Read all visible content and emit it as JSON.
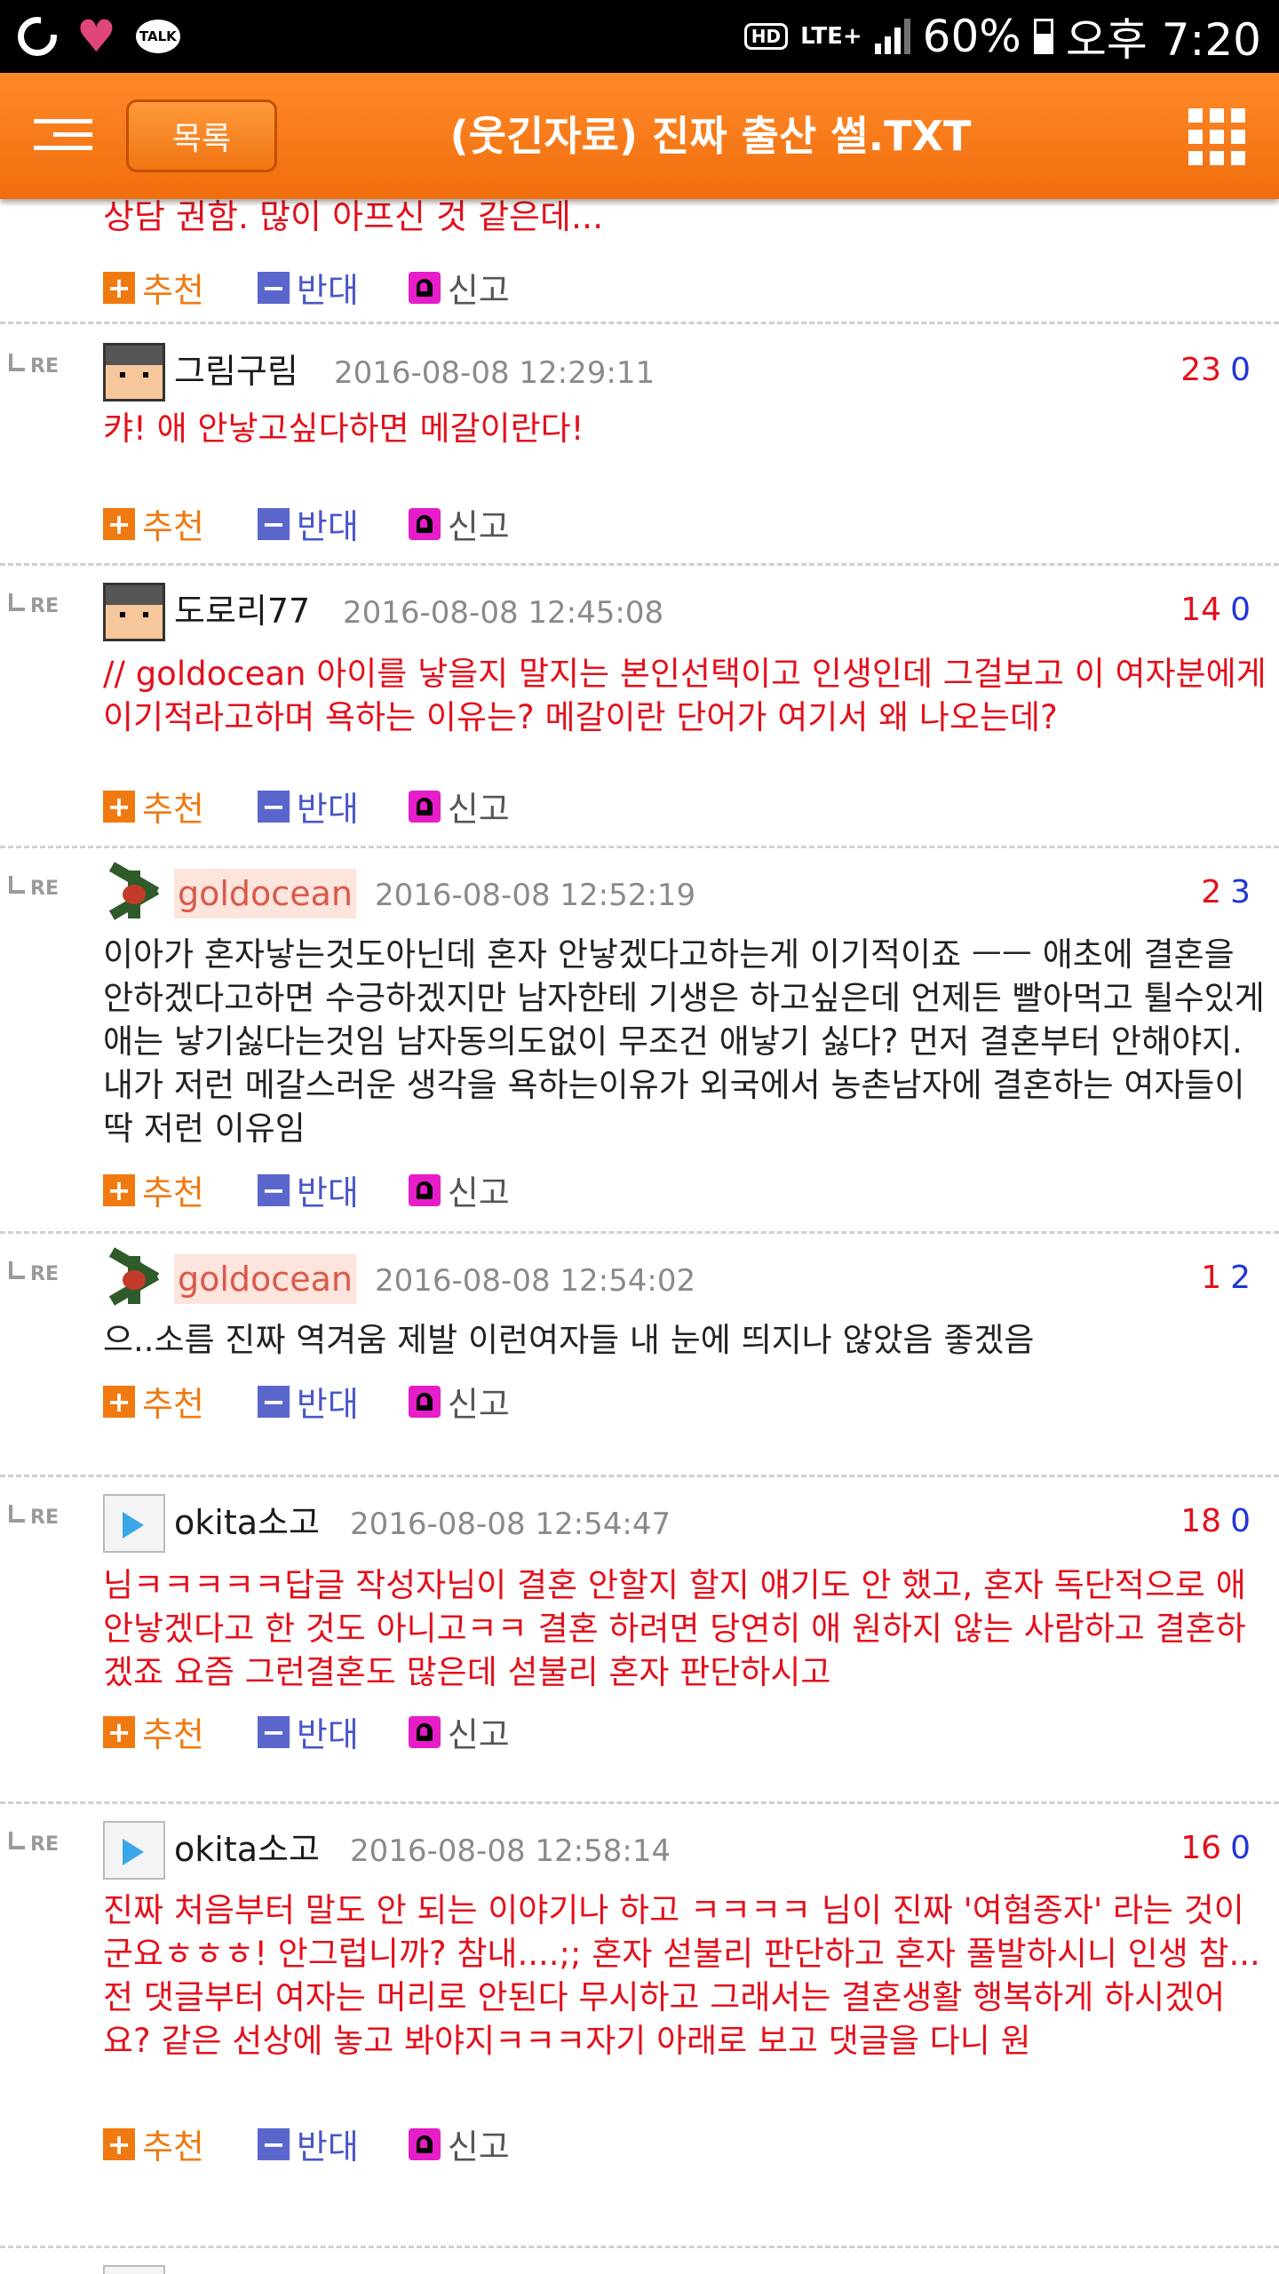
{
  "status_bar": {
    "talk_label": "TALK",
    "hd_label": "HD",
    "network": "LTE+",
    "battery": "60%",
    "time": "오후 7:20"
  },
  "header": {
    "list_button": "목록",
    "title": "(웃긴자료) 진짜 출산 썰.TXT"
  },
  "actions": {
    "recommend": "추천",
    "oppose": "반대",
    "report": "신고",
    "plus_glyph": "+",
    "minus_glyph": "−"
  },
  "reply_marker": "RE",
  "partial_comment_text": "상담 권함. 많이 아프신 것 같은데...",
  "comments": [
    {
      "author": "그림구림",
      "date": "2016-08-08 12:29:11",
      "up": "23",
      "down": "0",
      "text": "캬! 애 안낳고싶다하면 메갈이란다!"
    },
    {
      "author": "도로리77",
      "date": "2016-08-08 12:45:08",
      "up": "14",
      "down": "0",
      "text": "// goldocean 아이를 낳을지 말지는 본인선택이고 인생인데 그걸보고 이 여자분에게 이기적라고하며 욕하는 이유는? 메갈이란 단어가 여기서 왜 나오는데?"
    },
    {
      "author": "goldocean",
      "date": "2016-08-08 12:52:19",
      "up": "2",
      "down": "3",
      "text": "이아가 혼자낳는것도아닌데 혼자 안낳겠다고하는게 이기적이죠 ㅡㅡ 애초에 결혼을 안하겠다고하면 수긍하겠지만 남자한테 기생은 하고싶은데 언제든 빨아먹고 튈수있게 애는 낳기싫다는것임 남자동의도없이 무조건 애낳기 싫다? 먼저 결혼부터 안해야지. 내가 저런 메갈스러운 생각을 욕하는이유가 외국에서 농촌남자에 결혼하는 여자들이 딱 저런 이유임"
    },
    {
      "author": "goldocean",
      "date": "2016-08-08 12:54:02",
      "up": "1",
      "down": "2",
      "text": "으..소름 진짜 역겨움 제발 이런여자들 내 눈에 띄지나 않았음 좋겠음"
    },
    {
      "author": "okita소고",
      "date": "2016-08-08 12:54:47",
      "up": "18",
      "down": "0",
      "text": "님ㅋㅋㅋㅋㅋ답글 작성자님이 결혼 안할지 할지 얘기도 안 했고, 혼자 독단적으로 애 안낳겠다고 한 것도 아니고ㅋㅋ 결혼 하려면 당연히 애 원하지 않는 사람하고 결혼하겠죠 요즘 그런결혼도 많은데 섣불리 혼자 판단하시고"
    },
    {
      "author": "okita소고",
      "date": "2016-08-08 12:58:14",
      "up": "16",
      "down": "0",
      "text": "진짜 처음부터 말도 안 되는 이야기나 하고 ㅋㅋㅋㅋ 님이 진짜 '여혐종자' 라는 것이군요ㅎㅎㅎ! 안그럽니까? 참내....;; 혼자 섣불리 판단하고 혼자 풀발하시니 인생 참... 전 댓글부터 여자는 머리로 안된다 무시하고 그래서는 결혼생활 행복하게 하시겠어요? 같은 선상에 놓고 봐야지ㅋㅋㅋ자기 아래로 보고 댓글을 다니 원"
    }
  ]
}
